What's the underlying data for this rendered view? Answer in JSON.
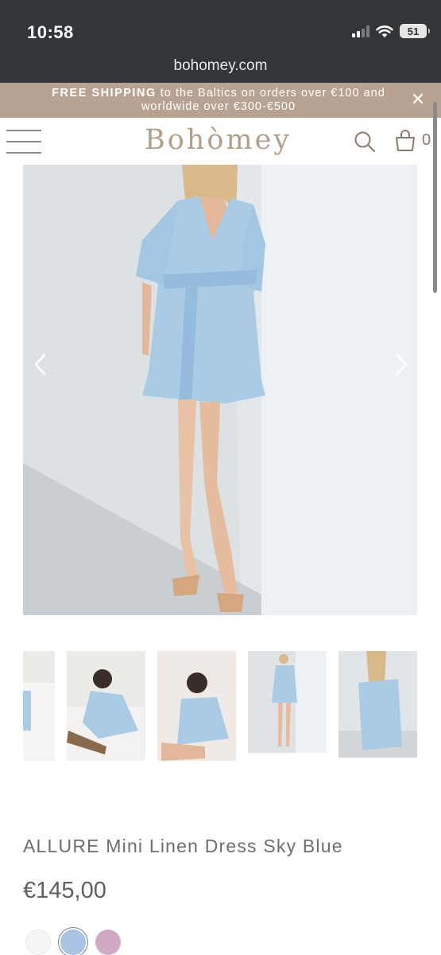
{
  "status_bar": {
    "time": "10:58",
    "battery": "51"
  },
  "browser": {
    "url": "bohomey.com"
  },
  "announcement": {
    "strong": "FREE SHIPPING",
    "line1_rest": " to the Baltics on orders over €100 and",
    "line2": "worldwide over €300-€500",
    "close": "✕"
  },
  "header": {
    "logo": "Bohòmey",
    "cart_count": "0"
  },
  "product": {
    "title": "ALLURE Mini Linen Dress Sky Blue",
    "price": "€145,00",
    "swatches": [
      {
        "name": "white",
        "color": "#f7f5f4"
      },
      {
        "name": "sky-blue",
        "color": "#a9c4e2",
        "selected": true
      },
      {
        "name": "pink",
        "color": "#d2a9c4"
      }
    ]
  },
  "colors": {
    "accent": "#b8a392",
    "logo": "#b49e8a",
    "dress": "#a9cbe6"
  },
  "icons": [
    "hamburger-icon",
    "search-icon",
    "bag-icon",
    "chevron-left-icon",
    "chevron-right-icon",
    "close-icon"
  ]
}
